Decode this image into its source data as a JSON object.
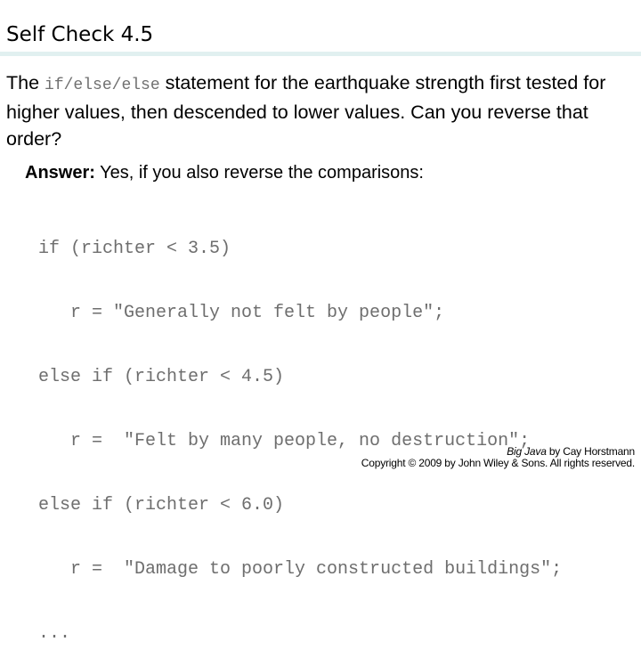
{
  "slide": {
    "title": "Self Check 4.5",
    "question": {
      "prefix": "The ",
      "inline_code": "if/else/else",
      "suffix": " statement for the earthquake strength first tested for higher values, then descended to lower values. Can you reverse that order?"
    },
    "answer": {
      "label": "Answer:",
      "text": " Yes, if you also reverse the comparisons:"
    },
    "code_lines": [
      "if (richter < 3.5)",
      "   r = \"Generally not felt by people\";",
      "else if (richter < 4.5)",
      "   r =  \"Felt by many people, no destruction\";",
      "else if (richter < 6.0)",
      "   r =  \"Damage to poorly constructed buildings\";",
      "..."
    ]
  },
  "footer": {
    "book_title": "Big Java",
    "author_line": " by Cay Horstmann",
    "copyright": "Copyright © 2009 by John Wiley & Sons.  All rights reserved."
  },
  "colors": {
    "title_rule": "#e1f0f0",
    "code_text": "#6e6e6e",
    "body_text": "#000000"
  }
}
